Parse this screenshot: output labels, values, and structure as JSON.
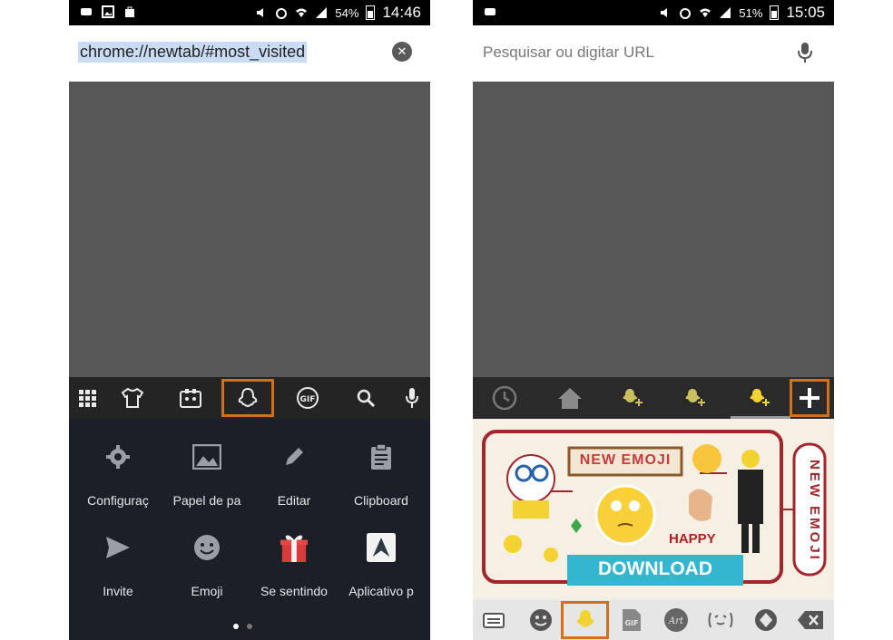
{
  "left_phone": {
    "status_bar": {
      "battery": "54%",
      "time": "14:46"
    },
    "url_bar": {
      "value": "chrome://newtab/#most_visited",
      "clear_icon": "close-circle-icon"
    },
    "keyboard_toolbar": {
      "icons": [
        "grid-icon",
        "theme-shirt-icon",
        "sticker-icon",
        "ghost-icon",
        "gif-icon",
        "search-icon",
        "mic-icon"
      ],
      "highlighted": "ghost-icon",
      "highlight_color": "#d2711a"
    },
    "menu": {
      "items": [
        {
          "label": "Configuraç",
          "icon": "gear-icon"
        },
        {
          "label": "Papel de pa",
          "icon": "image-icon"
        },
        {
          "label": "Editar",
          "icon": "pencil-icon"
        },
        {
          "label": "Clipboard",
          "icon": "clipboard-icon"
        },
        {
          "label": "Invite",
          "icon": "send-icon"
        },
        {
          "label": "Emoji",
          "icon": "smiley-icon"
        },
        {
          "label": "Se sentindo",
          "icon": "gift-icon"
        },
        {
          "label": "Aplicativo p",
          "icon": "app-icon"
        }
      ],
      "page": 1,
      "pages": 2
    }
  },
  "right_phone": {
    "status_bar": {
      "battery": "51%",
      "time": "15:05"
    },
    "url_bar": {
      "placeholder": "Pesquisar ou digitar URL",
      "mic_icon": "mic-icon"
    },
    "sticker_toolbar": {
      "icons": [
        "clock-icon",
        "home-icon",
        "ghost-pack-icon",
        "ghost-pack-icon",
        "ghost-pack-icon",
        "plus-icon"
      ],
      "highlighted": "plus-icon"
    },
    "banner": {
      "title": "NEW EMOJI",
      "side_text": "NEW EMOJI",
      "happy": "HAPPY",
      "download": "DOWNLOAD"
    },
    "emoji_bar": {
      "icons": [
        "keyboard-icon",
        "smiley-icon",
        "ghost-icon",
        "gif-icon",
        "art-text-icon",
        "kaomoji-icon",
        "sticker-icon",
        "backspace-icon"
      ],
      "gif_label": "GIF",
      "art_label": "Art",
      "highlighted": "ghost-icon"
    }
  }
}
